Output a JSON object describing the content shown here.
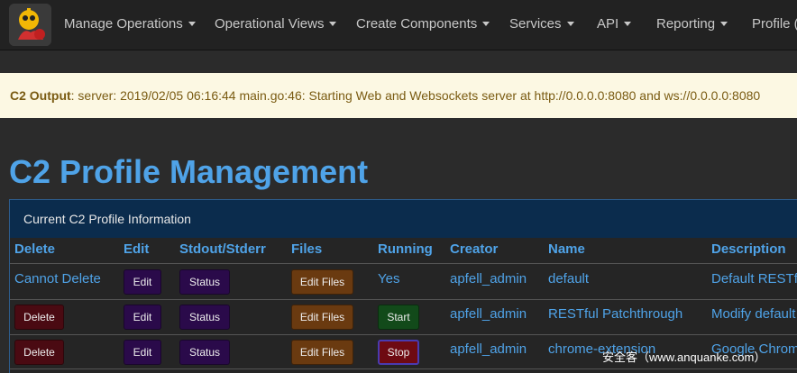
{
  "nav": {
    "items": [
      {
        "label": "Manage Operations"
      },
      {
        "label": "Operational Views"
      },
      {
        "label": "Create Components"
      },
      {
        "label": "Services"
      },
      {
        "label": "API"
      },
      {
        "label": "Reporting"
      },
      {
        "label": "Profile (a"
      }
    ]
  },
  "alert": {
    "prefix": "C2 Output",
    "message": ": server: 2019/02/05 06:16:44 main.go:46: Starting Web and Websockets server at http://0.0.0.0:8080 and ws://0.0.0.0:8080"
  },
  "page": {
    "title": "C2 Profile Management"
  },
  "panel": {
    "heading": "Current C2 Profile Information"
  },
  "table": {
    "headers": [
      "Delete",
      "Edit",
      "Stdout/Stderr",
      "Files",
      "Running",
      "Creator",
      "Name",
      "Description"
    ],
    "rows": [
      {
        "delete": "Cannot Delete",
        "edit": "Edit",
        "status": "Status",
        "files": "Edit Files",
        "running": "Yes",
        "creator": "apfell_admin",
        "name": "default",
        "description": "Default RESTfu"
      },
      {
        "delete": "Delete",
        "edit": "Edit",
        "status": "Status",
        "files": "Edit Files",
        "running": "Start",
        "creator": "apfell_admin",
        "name": "RESTful Patchthrough",
        "description": "Modify default I"
      },
      {
        "delete": "Delete",
        "edit": "Edit",
        "status": "Status",
        "files": "Edit Files",
        "running": "Stop",
        "creator": "apfell_admin",
        "name": "chrome-extension",
        "description": "Google Chrome"
      }
    ]
  },
  "watermark": "安全客（www.anquanke.com）",
  "colors": {
    "link": "#4fa3e8",
    "alert_bg": "#fcf8e3",
    "panel_heading": "#0b2c4d"
  }
}
